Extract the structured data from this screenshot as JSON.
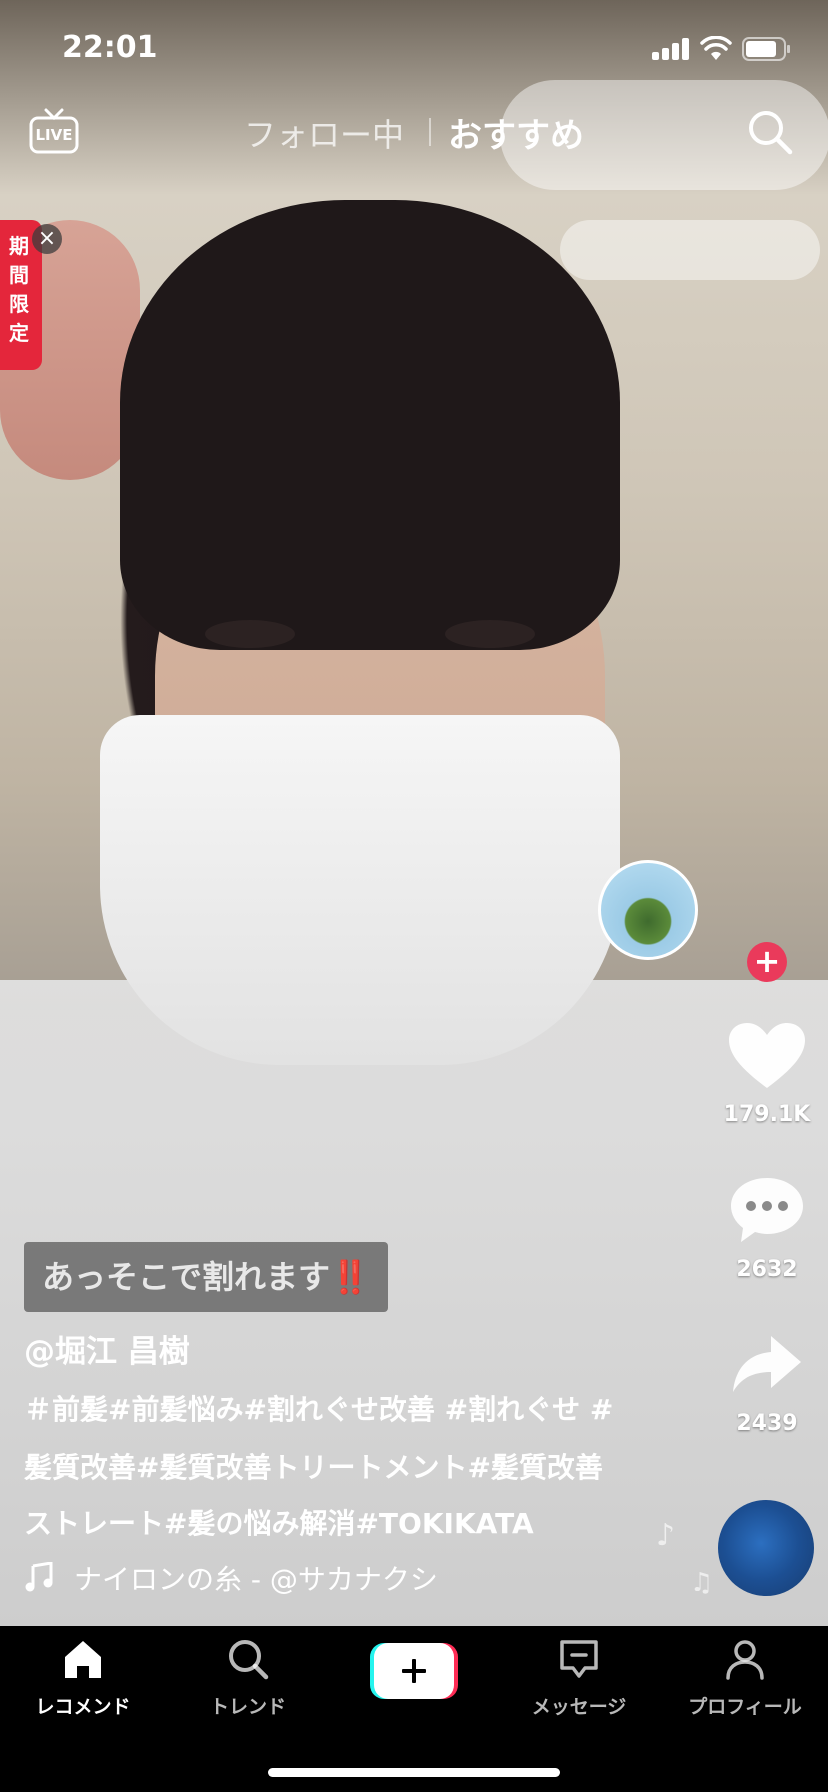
{
  "status_bar": {
    "time": "22:01"
  },
  "top_nav": {
    "live_label": "LIVE",
    "tabs": [
      {
        "label": "フォロー中",
        "active": false
      },
      {
        "label": "おすすめ",
        "active": true
      }
    ]
  },
  "promo": {
    "label": "期間限定"
  },
  "actions": {
    "likes": "179.1K",
    "comments": "2632",
    "shares": "2439"
  },
  "video": {
    "overlay_text": "あっそこで割れます‼️",
    "author": "@堀江 昌樹",
    "caption_lines": [
      "＃前髪#前髪悩み#割れぐせ改善 #割れぐせ #",
      "髪質改善#髪質改善トリートメント#髪質改善",
      "ストレート#髪の悩み解消#TOKIKATA"
    ],
    "music": "ナイロンの糸 - @サカナクシ"
  },
  "bottom_nav": {
    "items": [
      {
        "label": "レコメンド",
        "icon": "home-icon",
        "active": true
      },
      {
        "label": "トレンド",
        "icon": "search-icon",
        "active": false
      },
      {
        "label": "",
        "icon": "create-plus-icon",
        "active": false
      },
      {
        "label": "メッセージ",
        "icon": "inbox-icon",
        "active": false
      },
      {
        "label": "プロフィール",
        "icon": "profile-icon",
        "active": false
      }
    ]
  },
  "colors": {
    "accent_red": "#ea3a5b",
    "promo_red": "#e4263b",
    "create_cyan": "#25f4ee",
    "create_pink": "#fe2c55"
  }
}
